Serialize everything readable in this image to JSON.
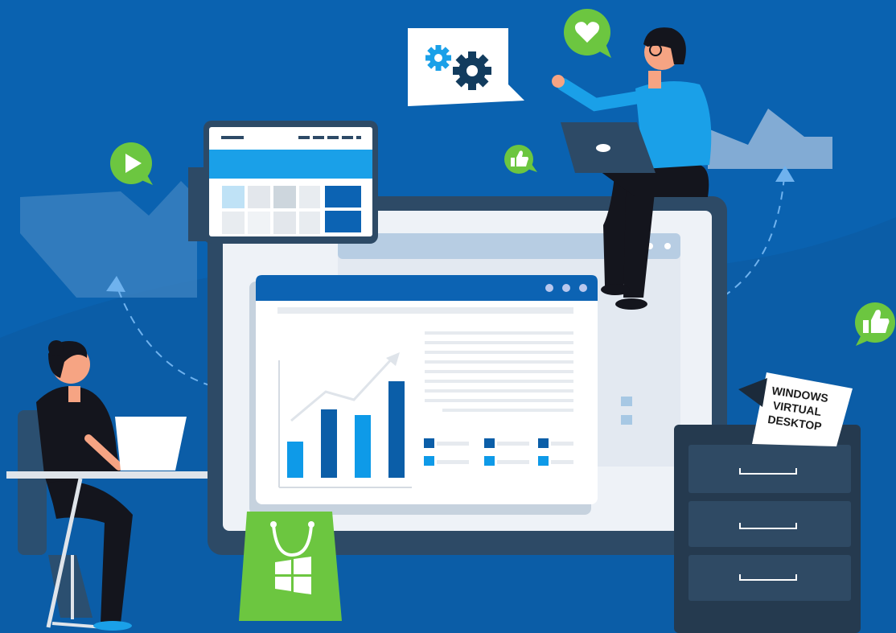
{
  "sign": {
    "line1": "WINDOWS",
    "line2": "VIRTUAL",
    "line3": "DESKTOP"
  },
  "chart_data": {
    "type": "bar",
    "categories": [
      "",
      "",
      "",
      ""
    ],
    "values": [
      45,
      85,
      78,
      120
    ],
    "ylim": [
      0,
      130
    ],
    "grid": false,
    "title": "",
    "xlabel": "",
    "ylabel": ""
  },
  "colors": {
    "background": "#0a62b0",
    "accent_green": "#6cc640",
    "bar_light": "#0e9ae8",
    "bar_dark": "#0b5ea8",
    "monitor_frame": "#2d4a66"
  },
  "icons": {
    "speech_bubble_gears": "gears-icon",
    "heart_bubble": "heart-icon",
    "play_bubble": "play-icon",
    "thumbs_up_small": "thumbs-up-icon",
    "thumbs_up_right": "thumbs-up-icon",
    "shopping_bag": "windows-logo-icon"
  }
}
